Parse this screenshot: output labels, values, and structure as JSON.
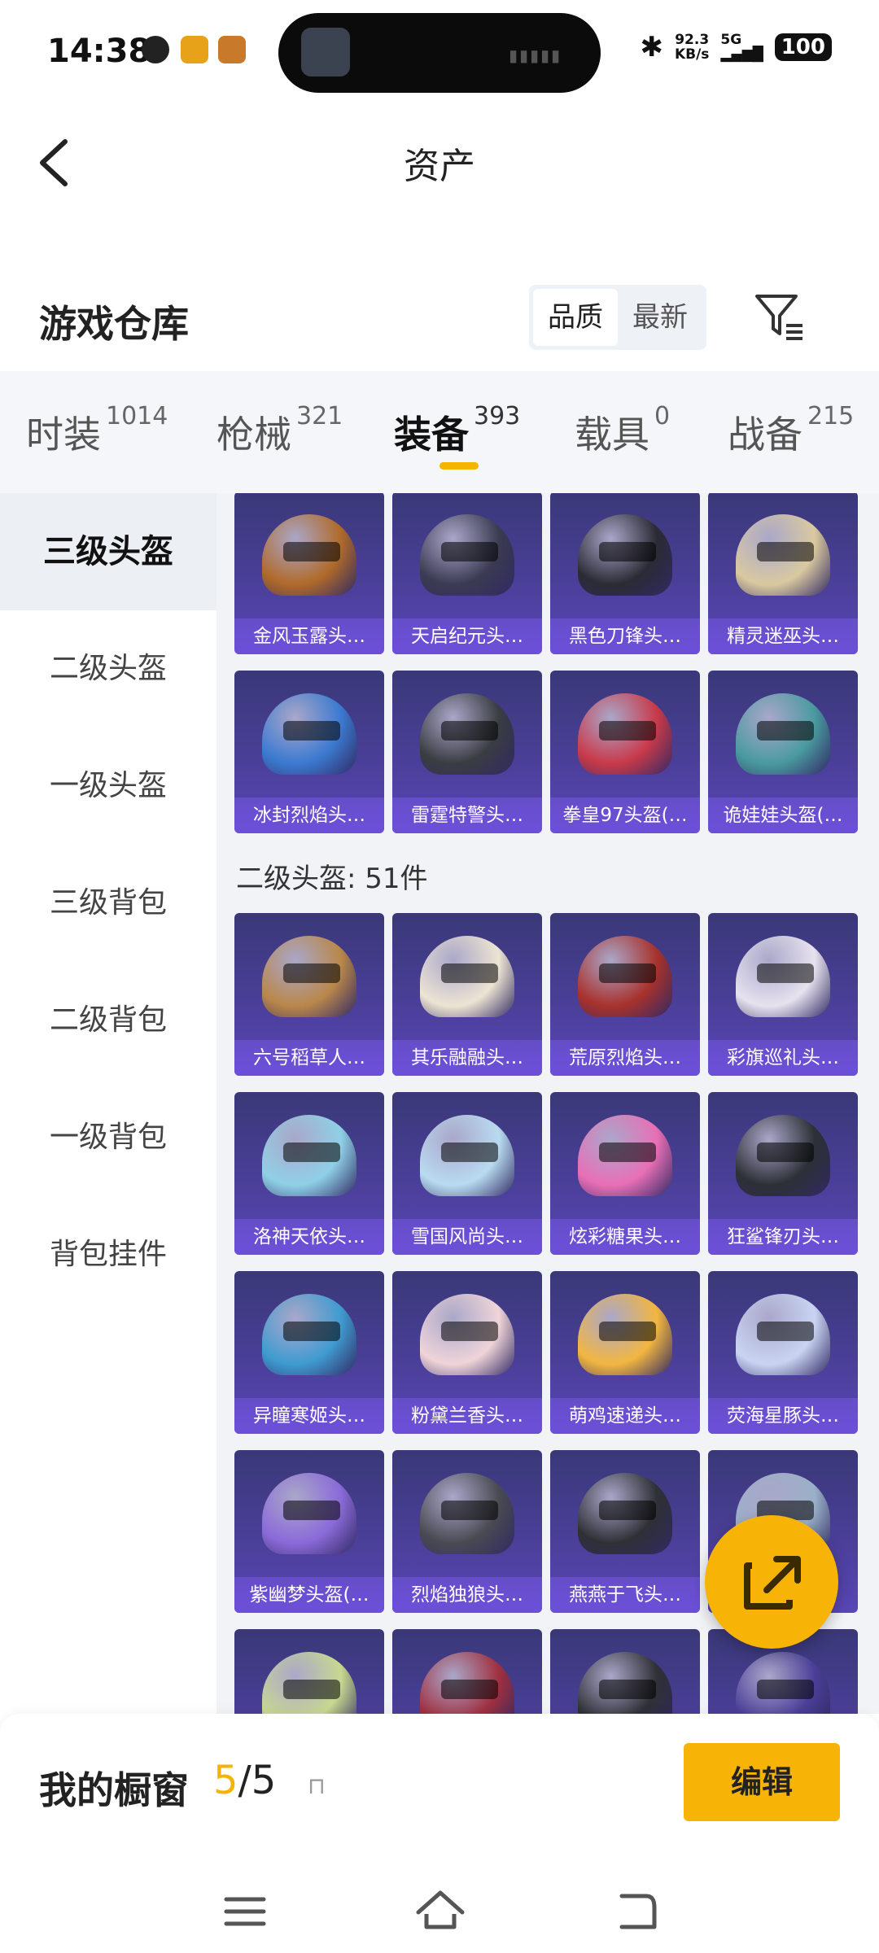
{
  "status_bar": {
    "time": "14:38",
    "speed_value": "92.3",
    "speed_unit": "KB/s",
    "network": "5G",
    "battery": "100"
  },
  "header": {
    "title": "资产"
  },
  "warehouse": {
    "title": "游戏仓库",
    "sort_options": [
      "品质",
      "最新"
    ]
  },
  "tabs": [
    {
      "label": "时装",
      "count": "1014"
    },
    {
      "label": "枪械",
      "count": "321"
    },
    {
      "label": "装备",
      "count": "393"
    },
    {
      "label": "载具",
      "count": "0"
    },
    {
      "label": "战备",
      "count": "215"
    }
  ],
  "sidebar": {
    "items": [
      {
        "label": "三级头盔"
      },
      {
        "label": "二级头盔"
      },
      {
        "label": "一级头盔"
      },
      {
        "label": "三级背包"
      },
      {
        "label": "二级背包"
      },
      {
        "label": "一级背包"
      },
      {
        "label": "背包挂件"
      }
    ]
  },
  "grid": {
    "top_items": [
      {
        "name": "金风玉露头…",
        "color": "#b06a2a"
      },
      {
        "name": "天启纪元头…",
        "color": "#3b3b52"
      },
      {
        "name": "黑色刀锋头…",
        "color": "#2b2b35"
      },
      {
        "name": "精灵迷巫头…",
        "color": "#d9c9a0"
      },
      {
        "name": "冰封烈焰头…",
        "color": "#3b7ad0"
      },
      {
        "name": "雷霆特警头…",
        "color": "#3a3d42"
      },
      {
        "name": "拳皇97头盔(…",
        "color": "#c83a4a"
      },
      {
        "name": "诡娃娃头盔(…",
        "color": "#4a9aa0"
      }
    ],
    "section_title": "二级头盔: 51件",
    "items": [
      {
        "name": "六号稻草人…",
        "color": "#b9874a"
      },
      {
        "name": "其乐融融头…",
        "color": "#ece4d2"
      },
      {
        "name": "荒原烈焰头…",
        "color": "#a8322c"
      },
      {
        "name": "彩旗巡礼头…",
        "color": "#e6e2ee"
      },
      {
        "name": "洛神天依头…",
        "color": "#8fd0e6"
      },
      {
        "name": "雪国风尚头…",
        "color": "#b8dbf0"
      },
      {
        "name": "炫彩糖果头…",
        "color": "#e86fb6"
      },
      {
        "name": "狂鲨锋刃头…",
        "color": "#2d3036"
      },
      {
        "name": "异瞳寒姬头…",
        "color": "#3f9bd0"
      },
      {
        "name": "粉黛兰香头…",
        "color": "#efd4d8"
      },
      {
        "name": "萌鸡速递头…",
        "color": "#f2b640"
      },
      {
        "name": "荧海星豚头…",
        "color": "#c9d4f2"
      },
      {
        "name": "紫幽梦头盔(…",
        "color": "#8a6ad8"
      },
      {
        "name": "烈焰独狼头…",
        "color": "#4a4a52"
      },
      {
        "name": "燕燕于飞头…",
        "color": "#2f3036"
      },
      {
        "name": "",
        "color": "#9ab0c8"
      },
      {
        "name": "",
        "color": "#c8d890"
      },
      {
        "name": "",
        "color": "#a03040"
      },
      {
        "name": "",
        "color": "#303036"
      },
      {
        "name": "",
        "color": "#4a3f98"
      }
    ]
  },
  "showcase": {
    "label": "我的橱窗",
    "current": "5",
    "total": "/5",
    "edit_label": "编辑"
  },
  "colors": {
    "accent": "#f8b406",
    "card_top": "#3a3878",
    "card_bottom": "#5a46b8"
  }
}
